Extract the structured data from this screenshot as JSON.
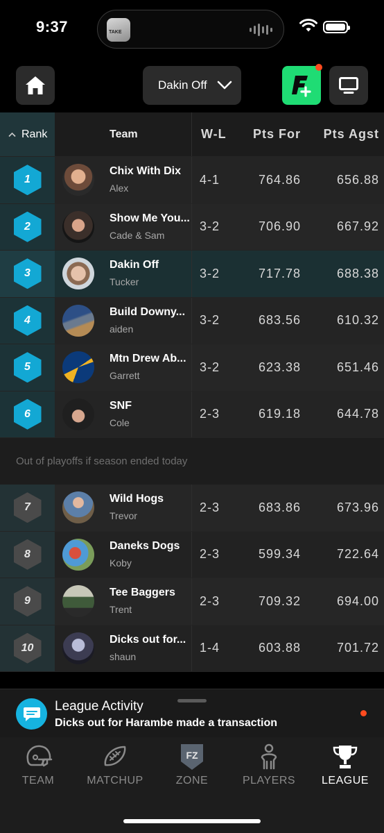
{
  "status_bar": {
    "time": "9:37",
    "island_label": "TAKE"
  },
  "top_bar": {
    "team_selected": "Dakin Off"
  },
  "table": {
    "headers": {
      "rank": "Rank",
      "team": "Team",
      "wl": "W-L",
      "pts_for": "Pts For",
      "pts_agst": "Pts Agst"
    },
    "playoff_rows": [
      {
        "rank": "1",
        "team": "Chix With Dix",
        "owner": "Alex",
        "wl": "4-1",
        "pf": "764.86",
        "pa": "656.88"
      },
      {
        "rank": "2",
        "team": "Show Me You...",
        "owner": "Cade & Sam",
        "wl": "3-2",
        "pf": "706.90",
        "pa": "667.92"
      },
      {
        "rank": "3",
        "team": "Dakin Off",
        "owner": "Tucker",
        "wl": "3-2",
        "pf": "717.78",
        "pa": "688.38"
      },
      {
        "rank": "4",
        "team": "Build Downy...",
        "owner": "aiden",
        "wl": "3-2",
        "pf": "683.56",
        "pa": "610.32"
      },
      {
        "rank": "5",
        "team": "Mtn Drew Ab...",
        "owner": "Garrett",
        "wl": "3-2",
        "pf": "623.38",
        "pa": "651.46"
      },
      {
        "rank": "6",
        "team": "SNF",
        "owner": "Cole",
        "wl": "2-3",
        "pf": "619.18",
        "pa": "644.78"
      }
    ],
    "divider_text": "Out of playoffs if season ended today",
    "out_rows": [
      {
        "rank": "7",
        "team": "Wild Hogs",
        "owner": "Trevor",
        "wl": "2-3",
        "pf": "683.86",
        "pa": "673.96"
      },
      {
        "rank": "8",
        "team": "Daneks Dogs",
        "owner": "Koby",
        "wl": "2-3",
        "pf": "599.34",
        "pa": "722.64"
      },
      {
        "rank": "9",
        "team": "Tee Baggers",
        "owner": "Trent",
        "wl": "2-3",
        "pf": "709.32",
        "pa": "694.00"
      },
      {
        "rank": "10",
        "team": "Dicks out for...",
        "owner": "shaun",
        "wl": "1-4",
        "pf": "603.88",
        "pa": "701.72"
      }
    ]
  },
  "activity": {
    "title": "League Activity",
    "subtitle": "Dicks out for Harambe made a transaction"
  },
  "nav": {
    "items": [
      {
        "label": "TEAM",
        "icon": "helmet-icon"
      },
      {
        "label": "MATCHUP",
        "icon": "football-icon"
      },
      {
        "label": "ZONE",
        "icon": "fz-shield-icon",
        "badge": "FZ"
      },
      {
        "label": "PLAYERS",
        "icon": "player-icon"
      },
      {
        "label": "LEAGUE",
        "icon": "trophy-icon"
      }
    ],
    "active": "LEAGUE"
  },
  "colors": {
    "accent": "#13a8d4",
    "brand_green": "#1fdc74",
    "notification": "#ff4b1f",
    "current_team_row": "#1b3033"
  }
}
